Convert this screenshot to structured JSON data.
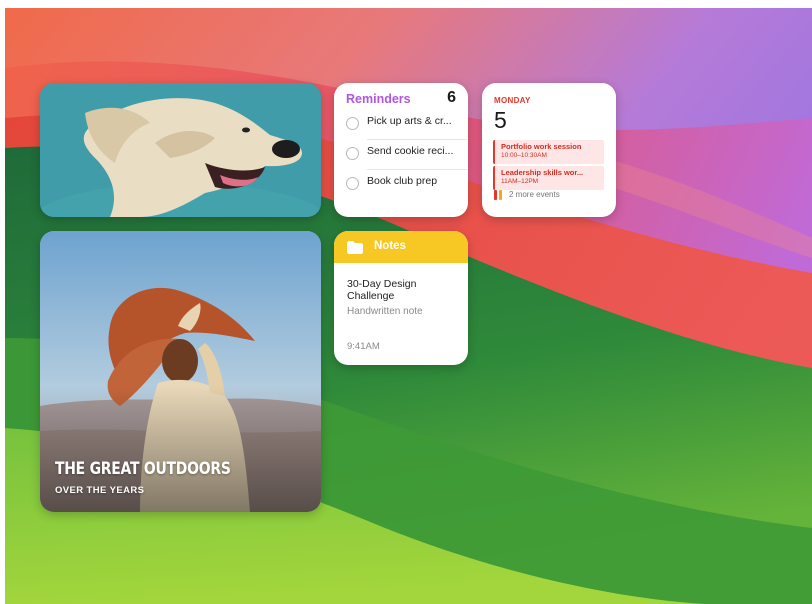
{
  "photo_widget_1": {
    "subject": "dog-photo"
  },
  "reminders": {
    "title": "Reminders",
    "count": "6",
    "items": [
      {
        "label": "Pick up arts & cr..."
      },
      {
        "label": "Send cookie reci..."
      },
      {
        "label": "Book club prep"
      }
    ]
  },
  "calendar": {
    "day": "MONDAY",
    "date": "5",
    "events": [
      {
        "title": "Portfolio work session",
        "time": "10:00–10:30AM"
      },
      {
        "title": "Leadership skills wor...",
        "time": "11AM–12PM"
      }
    ],
    "more": "2 more events",
    "more_colors": [
      "#e5362a",
      "#f5a623"
    ]
  },
  "photo_widget_2": {
    "title": "THE GREAT OUTDOORS",
    "subtitle": "OVER THE YEARS"
  },
  "notes": {
    "label": "Notes",
    "note_title": "30-Day Design Challenge",
    "note_subtitle": "Handwritten note",
    "time": "9:41AM"
  },
  "colors": {
    "reminders_accent": "#b056e0",
    "calendar_accent": "#e5362a",
    "notes_accent": "#f7c824"
  }
}
